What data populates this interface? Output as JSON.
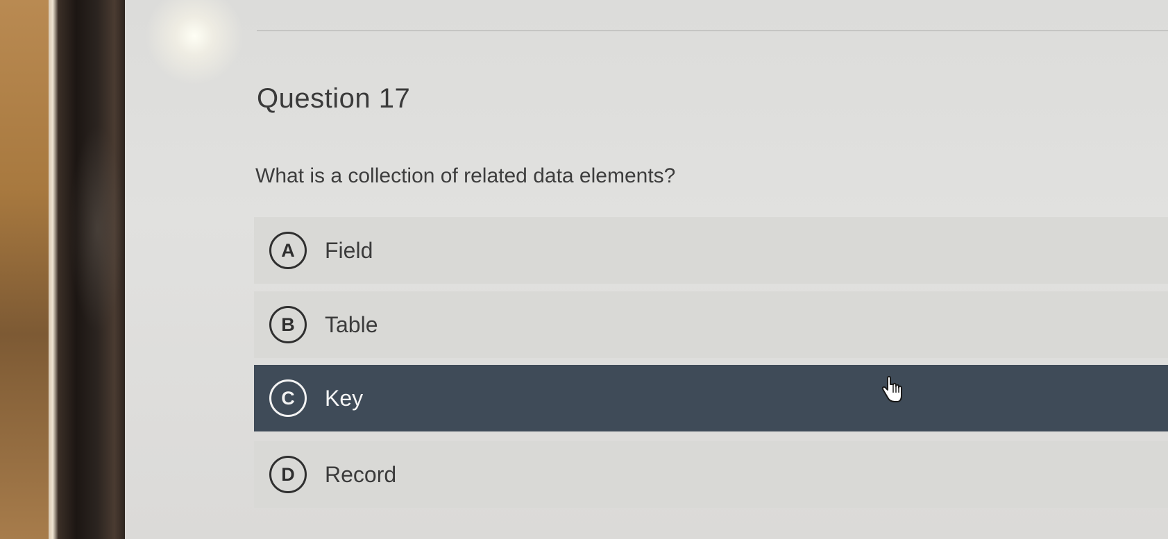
{
  "question": {
    "title": "Question 17",
    "text": "What is a collection of related data elements?"
  },
  "options": [
    {
      "letter": "A",
      "label": "Field",
      "selected": false
    },
    {
      "letter": "B",
      "label": "Table",
      "selected": false
    },
    {
      "letter": "C",
      "label": "Key",
      "selected": true
    },
    {
      "letter": "D",
      "label": "Record",
      "selected": false
    }
  ],
  "colors": {
    "selected_background": "#3f4b58",
    "option_background": "#d9d9d6",
    "screen_background": "#dcdcda"
  },
  "icons": {
    "cursor": "hand-pointer-icon"
  }
}
